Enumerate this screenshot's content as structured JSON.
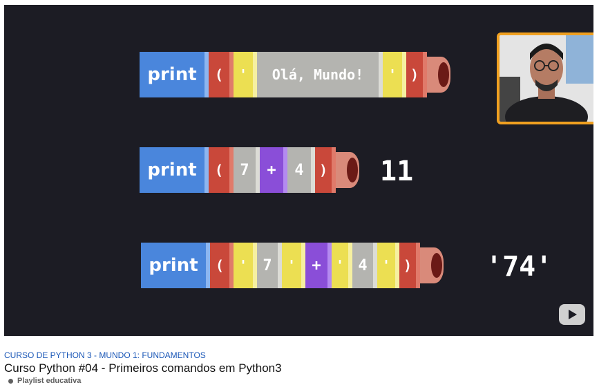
{
  "video": {
    "row1": {
      "print": "print",
      "open": "(",
      "q1": "'",
      "text": "Olá, Mundo!",
      "q2": "'",
      "close": ")"
    },
    "row2": {
      "print": "print",
      "open": "(",
      "a": "7",
      "op": "+",
      "b": "4",
      "close": ")",
      "result": "11"
    },
    "row3": {
      "print": "print",
      "open": "(",
      "q1": "'",
      "a": "7",
      "q2": "'",
      "op": "+",
      "q3": "'",
      "b": "4",
      "q4": "'",
      "close": ")",
      "result": "'74'"
    }
  },
  "meta": {
    "category": "CURSO DE PYTHON 3 - MUNDO 1: FUNDAMENTOS",
    "title": "Curso Python #04 - Primeiros comandos em Python3",
    "playlist": "Playlist educativa"
  },
  "colors": {
    "print": "#4a86dc",
    "paren": "#c9483a",
    "quote": "#ecdf52",
    "value": "#b4b4b0",
    "operator": "#8a4ed8",
    "frame": "#f0a020"
  }
}
